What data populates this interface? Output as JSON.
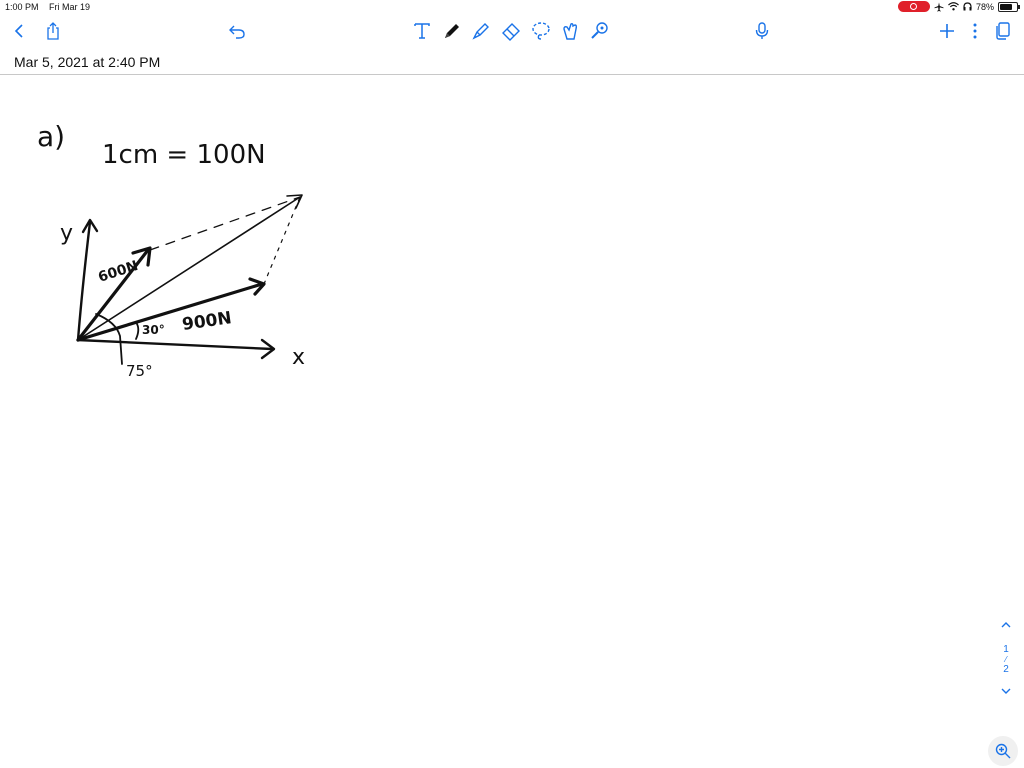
{
  "status_bar": {
    "time": "1:00 PM",
    "date": "Fri Mar 19",
    "battery_percent": "78%",
    "battery_level": 0.78
  },
  "toolbar": {
    "left_icons": [
      "back-chevron-icon",
      "share-icon"
    ],
    "undo_icon": "undo-icon",
    "center_tools": [
      "text-tool-icon",
      "pen-tool-icon",
      "highlighter-tool-icon",
      "eraser-tool-icon",
      "lasso-tool-icon",
      "shapes-tool-icon",
      "laser-pointer-icon"
    ],
    "mic_icon": "microphone-icon",
    "right_icons": [
      "add-icon",
      "more-vertical-icon",
      "pages-icon"
    ],
    "accent_color": "#1a73e8"
  },
  "note": {
    "date_title": "Mar 5, 2021 at 2:40 PM"
  },
  "handwriting": {
    "part_label": "a)",
    "scale": "1cm = 100N",
    "axis_y": "y",
    "axis_x": "x",
    "force_1": "600N",
    "force_2": "900N",
    "angle_1": "30°",
    "angle_2": "75°"
  },
  "page_nav": {
    "current": "1",
    "total": "2"
  }
}
